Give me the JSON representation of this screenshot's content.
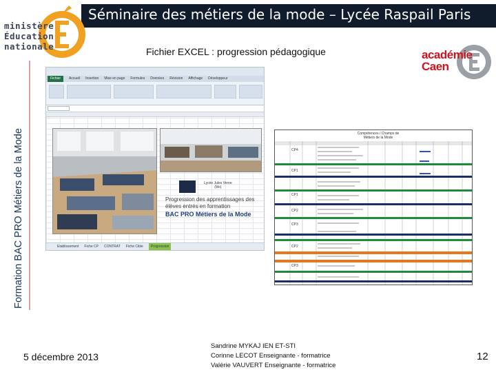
{
  "header": {
    "title": "Séminaire des métiers de la mode – Lycée Raspail Paris"
  },
  "ministry_logo": {
    "lines": [
      "ministère",
      "Éducation",
      "nationale"
    ]
  },
  "academy_logo": {
    "lines": [
      "académie",
      "Caen"
    ]
  },
  "subtitle": "Fichier EXCEL : progression pédagogique",
  "side_title": "Formation BAC PRO Métiers de la Mode",
  "excel": {
    "ribbon_tabs": [
      "Fichier",
      "Accueil",
      "Insertion",
      "Mise en page",
      "Formules",
      "Données",
      "Révision",
      "Affichage",
      "Développeur"
    ],
    "sheet_tabs": [
      "Etablissement",
      "Fiche CP",
      "CONTRAT",
      "Fiche Cible",
      "Progression"
    ],
    "active_sheet": 4,
    "cover": {
      "school": [
        "Lycée Jules Verne",
        "(Mo)"
      ],
      "heading": "Progression des apprentissages des élèves entrés en formation",
      "title": "BAC PRO Métiers de la Mode"
    }
  },
  "table_image": {
    "header": [
      "Compétences / Champs de",
      "Métiers de la Mode"
    ],
    "band_colors": [
      "#1e8a3c",
      "#1a2d6b",
      "#e8761c"
    ]
  },
  "colors": {
    "banner_bg": "#101c2c",
    "banner_text": "#ffffff",
    "academy_red": "#d0131e",
    "ministry_orange": "#f0a121"
  },
  "footer": {
    "date": "5 décembre 2013",
    "authors": [
      "Sandrine MYKAJ    IEN ET-STI",
      "Corinne LECOT   Enseignante - formatrice",
      "Valérie VAUVERT Enseignante - formatrice"
    ],
    "page_number": "12"
  }
}
